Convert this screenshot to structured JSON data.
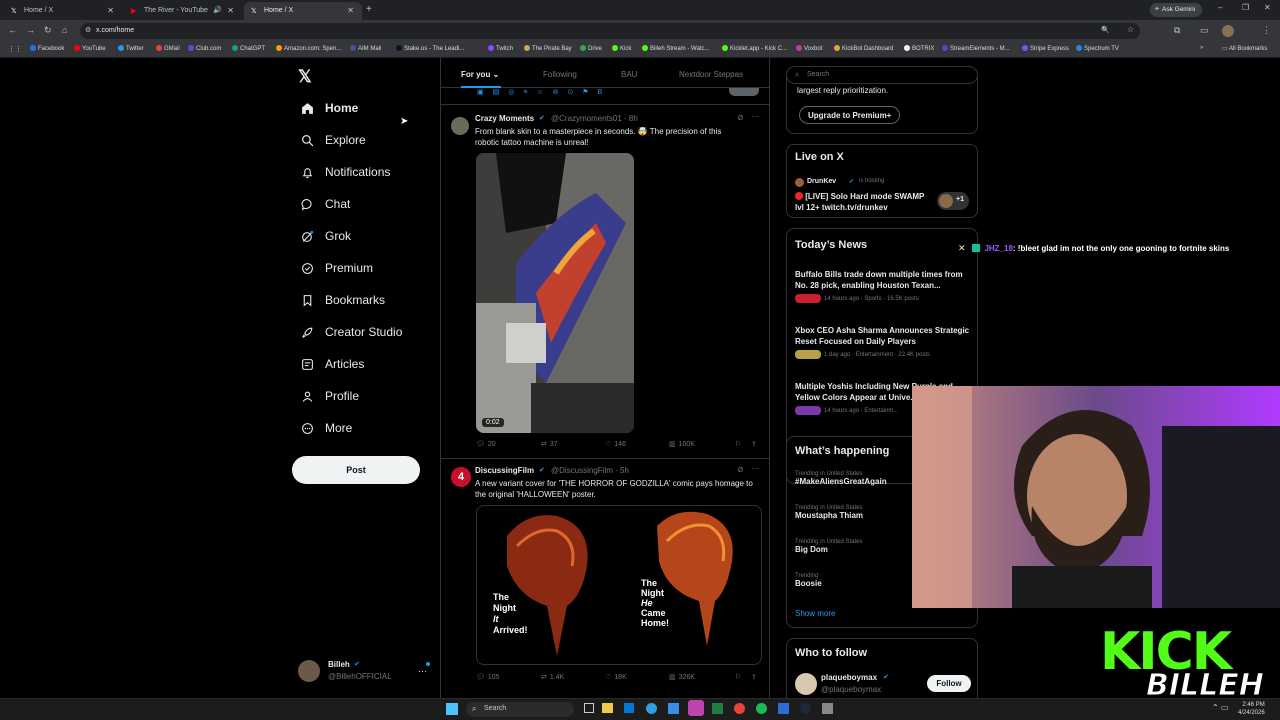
{
  "browser": {
    "tabs": [
      {
        "title": "Home / X",
        "icon": "x-logo-icon"
      },
      {
        "title": "The River - YouTube",
        "icon": "youtube-icon"
      },
      {
        "title": "Home / X",
        "icon": "x-logo-icon"
      }
    ],
    "url": "x.com/home",
    "ask_gemini": "Ask Gemini",
    "bookmarks": [
      "Facebook",
      "YouTube",
      "Twitter",
      "GMail",
      "Club.com",
      "ChatGPT",
      "Amazon.com: Spen...",
      "AIM Mail",
      "Stake.us - The Leadi...",
      "Twitch",
      "The Pirate Bay",
      "Drive",
      "Kick",
      "Billeh Stream - Watc...",
      "Kicklet.app - Kick C...",
      "Voxbot",
      "KickBot Dashboard",
      "BOTRIX",
      "StreamElements - M...",
      "Stripe Express",
      "Spectrum TV"
    ],
    "all_bookmarks": "All Bookmarks"
  },
  "nav": {
    "items": [
      {
        "label": "Home",
        "icon": "home-icon"
      },
      {
        "label": "Explore",
        "icon": "search-icon"
      },
      {
        "label": "Notifications",
        "icon": "bell-icon"
      },
      {
        "label": "Chat",
        "icon": "chat-icon"
      },
      {
        "label": "Grok",
        "icon": "grok-icon"
      },
      {
        "label": "Premium",
        "icon": "premium-icon"
      },
      {
        "label": "Bookmarks",
        "icon": "bookmark-icon"
      },
      {
        "label": "Creator Studio",
        "icon": "rocket-icon"
      },
      {
        "label": "Articles",
        "icon": "articles-icon"
      },
      {
        "label": "Profile",
        "icon": "person-icon"
      },
      {
        "label": "More",
        "icon": "more-icon"
      }
    ],
    "post_label": "Post",
    "account": {
      "name": "Billeh",
      "handle": "@BillehOFFICIAL"
    }
  },
  "feed": {
    "tabs": [
      "For you",
      "Following",
      "BAU",
      "Nextdoor Steppas"
    ],
    "tweets": [
      {
        "name": "Crazy Moments",
        "handle": "@Crazymoments01 · 8h",
        "text": "From blank skin to a masterpiece in seconds. 🤯 The precision of this robotic tattoo machine is unreal!",
        "video_time": "0:02",
        "replies": "20",
        "reposts": "37",
        "likes": "146",
        "views": "100K"
      },
      {
        "name": "DiscussingFilm",
        "handle": "@DiscussingFilm · 5h",
        "text": "A new variant cover for 'THE HORROR OF GODZILLA' comic pays homage to the original 'HALLOWEEN' poster.",
        "poster_left": [
          "The",
          "Night",
          "It",
          "Arrived!"
        ],
        "poster_right": [
          "The",
          "Night",
          "He",
          "Came",
          "Home!"
        ],
        "replies": "105",
        "reposts": "1.4K",
        "likes": "18K",
        "views": "326K"
      }
    ]
  },
  "right": {
    "search_placeholder": "Search",
    "premium_text": "largest reply prioritization.",
    "premium_button": "Upgrade to Premium+",
    "live": {
      "title": "Live on X",
      "host": "DrunKev",
      "hosting": "is hosting",
      "stream_title": "[LIVE] Solo Hard mode SWAMP lvl 12+ twitch.tv/drunkev",
      "extra": "+1"
    },
    "news": {
      "title": "Today’s News",
      "items": [
        {
          "title": "Buffalo Bills trade down multiple times from No. 28 pick, enabling Houston Texan...",
          "meta": "14 hours ago · Sports · 16.5K posts"
        },
        {
          "title": "Xbox CEO Asha Sharma Announces Strategic Reset Focused on Daily Players",
          "meta": "1 day ago · Entertainment · 22.4K posts"
        },
        {
          "title": "Multiple Yoshis Including New Purple and Yellow Colors Appear at Unive...",
          "meta": "14 hours ago · Entertainm..."
        }
      ]
    },
    "happening": {
      "title": "What’s happening",
      "trends": [
        {
          "cat": "Trending in United States",
          "name": "#MakeAliensGreatAgain"
        },
        {
          "cat": "Trending in United States",
          "name": "Moustapha Thiam"
        },
        {
          "cat": "Trending in United States",
          "name": "Big Dom"
        },
        {
          "cat": "Trending",
          "name": "Boosie"
        }
      ],
      "show_more": "Show more"
    },
    "follow": {
      "title": "Who to follow",
      "name": "plaqueboymax",
      "handle": "@plaqueboymax",
      "button": "Follow"
    }
  },
  "overlay": {
    "chat_user": "JHZ_18",
    "chat_message": ": !bleet glad im not the only one gooning to fortnite skins",
    "kick_text": "KICK",
    "streamer_tag": "BILLEH"
  },
  "taskbar": {
    "search": "Search",
    "time": "2:46 PM",
    "date": "4/24/2026"
  }
}
